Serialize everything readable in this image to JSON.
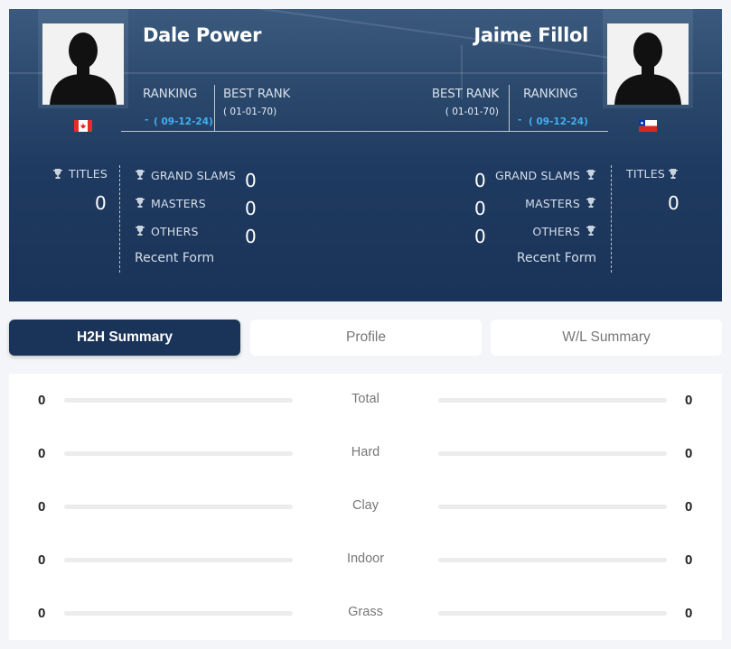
{
  "player1": {
    "name": "Dale Power",
    "ranking_label": "RANKING",
    "ranking_value": "-",
    "ranking_date": "( 09-12-24)",
    "best_rank_label": "BEST RANK",
    "best_rank_date": "( 01-01-70)",
    "flag": "canada-flag",
    "titles_label": "TITLES",
    "titles": "0",
    "grand_slams_label": "GRAND SLAMS",
    "grand_slams": "0",
    "masters_label": "MASTERS",
    "masters": "0",
    "others_label": "OTHERS",
    "others": "0",
    "recent_form_label": "Recent Form"
  },
  "player2": {
    "name": "Jaime Fillol",
    "ranking_label": "RANKING",
    "ranking_value": "-",
    "ranking_date": "( 09-12-24)",
    "best_rank_label": "BEST RANK",
    "best_rank_date": "( 01-01-70)",
    "flag": "chile-flag",
    "titles_label": "TITLES",
    "titles": "0",
    "grand_slams_label": "GRAND SLAMS",
    "grand_slams": "0",
    "masters_label": "MASTERS",
    "masters": "0",
    "others_label": "OTHERS",
    "others": "0",
    "recent_form_label": "Recent Form"
  },
  "tabs": [
    {
      "label": "H2H Summary",
      "active": true
    },
    {
      "label": "Profile",
      "active": false
    },
    {
      "label": "W/L Summary",
      "active": false
    }
  ],
  "summary": [
    {
      "label": "Total",
      "p1": "0",
      "p2": "0"
    },
    {
      "label": "Hard",
      "p1": "0",
      "p2": "0"
    },
    {
      "label": "Clay",
      "p1": "0",
      "p2": "0"
    },
    {
      "label": "Indoor",
      "p1": "0",
      "p2": "0"
    },
    {
      "label": "Grass",
      "p1": "0",
      "p2": "0"
    }
  ],
  "colors": {
    "hero_dark": "#1a3358",
    "accent_blue": "#3fb0f2",
    "tab_active": "#1a3358"
  }
}
